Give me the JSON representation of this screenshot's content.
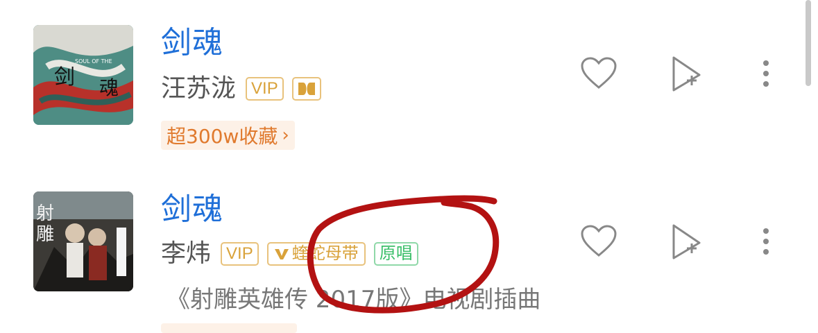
{
  "songs": [
    {
      "title": "剑魂",
      "artist": "汪苏泷",
      "badges": [
        "VIP"
      ],
      "tag": "超300w收藏",
      "cover_text_1": "剑",
      "cover_text_2": "魂",
      "cover_text_small": "SOUL OF THE"
    },
    {
      "title": "剑魂",
      "artist": "李炜",
      "badges": [
        "VIP",
        "蝰蛇母带",
        "原唱"
      ],
      "description": "《射雕英雄传 2017版》电视剧插曲",
      "cover_text_1": "射",
      "cover_text_2": "雕"
    }
  ],
  "icons": {
    "like": "heart-icon",
    "add": "add-to-playlist-icon",
    "more": "more-vertical-icon",
    "dolby": "dolby-icon",
    "viper": "viper-v-icon"
  },
  "colors": {
    "title": "#1f6fd8",
    "vip": "#d9a23a",
    "original": "#3bbf6a",
    "tag_bg": "#fdf1e7",
    "tag_text": "#e07a2e",
    "annotation": "#b31212"
  }
}
